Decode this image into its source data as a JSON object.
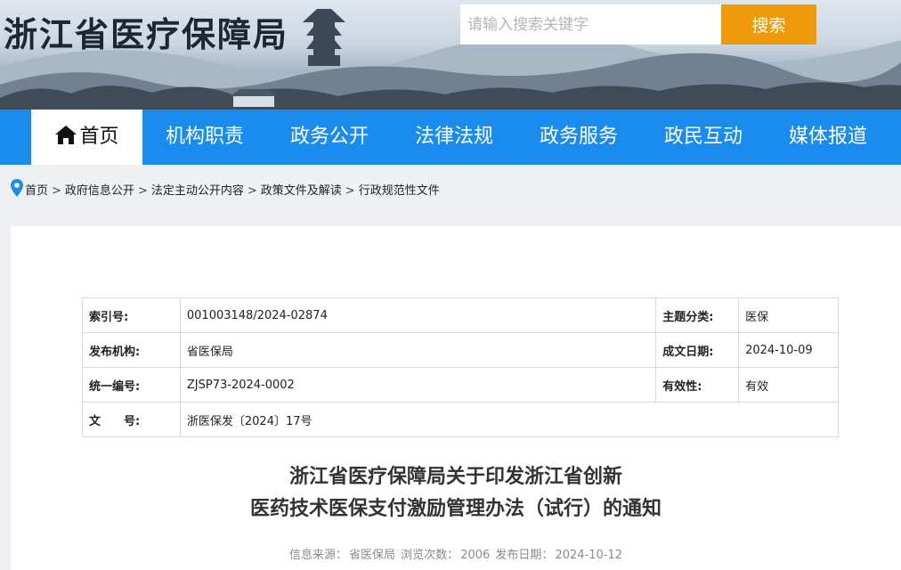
{
  "header": {
    "site_title": "浙江省医疗保障局",
    "search": {
      "placeholder": "请输入搜索关键字",
      "button_label": "搜索"
    }
  },
  "nav": {
    "items": [
      {
        "label": "首页",
        "active": true,
        "icon": "home-icon"
      },
      {
        "label": "机构职责"
      },
      {
        "label": "政务公开"
      },
      {
        "label": "法律法规"
      },
      {
        "label": "政务服务"
      },
      {
        "label": "政民互动"
      },
      {
        "label": "媒体报道"
      }
    ]
  },
  "breadcrumb": {
    "icon": "location-pin-icon",
    "items": [
      "首页",
      "政府信息公开",
      "法定主动公开内容",
      "政策文件及解读",
      "行政规范性文件"
    ],
    "separator": ">"
  },
  "meta": {
    "rows": [
      {
        "k1": "索引号:",
        "v1": "001003148/2024-02874",
        "k2": "主题分类:",
        "v2": "医保"
      },
      {
        "k1": "发布机构:",
        "v1": "省医保局",
        "k2": "成文日期:",
        "v2": "2024-10-09"
      },
      {
        "k1": "统一编号:",
        "v1": "ZJSP73-2024-0002",
        "k2": "有效性:",
        "v2": "有效"
      },
      {
        "k1": "文　　号:",
        "v1": "浙医保发〔2024〕17号"
      }
    ]
  },
  "document": {
    "title_line1": "浙江省医疗保障局关于印发浙江省创新",
    "title_line2": "医药技术医保支付激励管理办法（试行）的通知",
    "source_label": "信息来源：",
    "source": "省医保局",
    "views_label": "浏览次数：",
    "views": "2006",
    "date_label": "发布日期：",
    "date": "2024-10-12"
  },
  "colors": {
    "nav_bg": "#1a8cf0",
    "search_button": "#ee9a0a",
    "pin": "#1a8cf0"
  }
}
